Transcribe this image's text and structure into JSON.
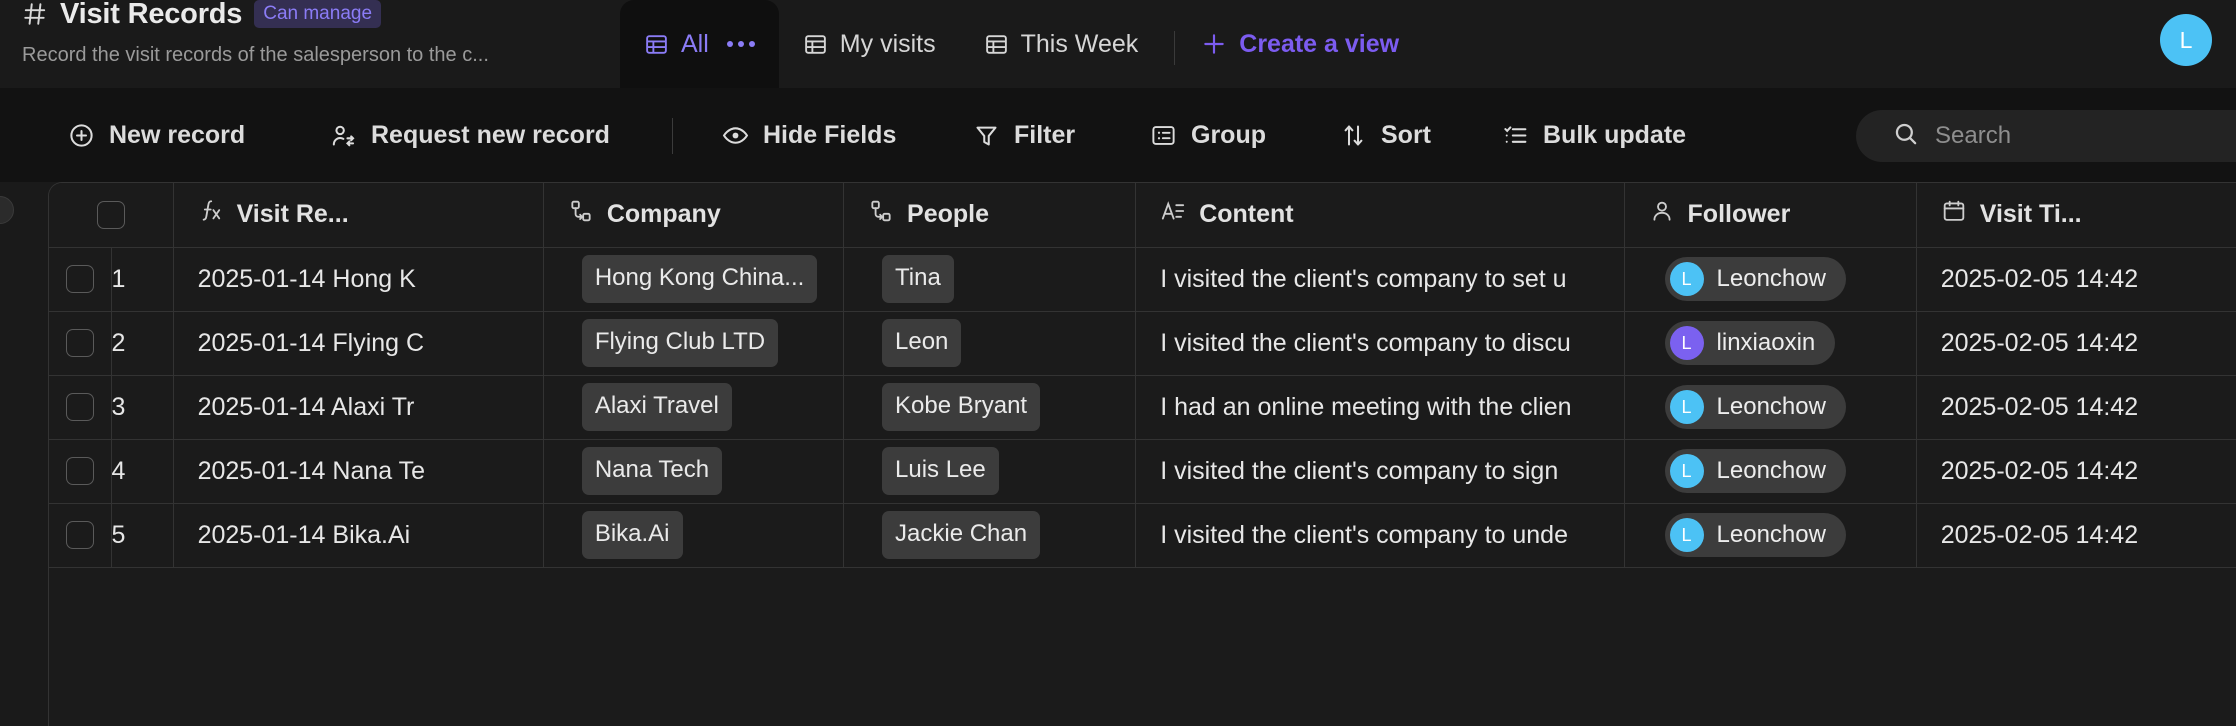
{
  "header": {
    "hash_icon": "hash-icon",
    "title": "Visit Records",
    "permission_badge": "Can manage",
    "subtitle": "Record the visit records of the salesperson to the c...",
    "avatar_initial": "L",
    "avatar_color": "#4cc2f5"
  },
  "tabs": {
    "items": [
      {
        "label": "All",
        "icon": "grid-table-icon",
        "active": true,
        "has_more": true
      },
      {
        "label": "My visits",
        "icon": "grid-table-icon",
        "active": false,
        "has_more": false
      },
      {
        "label": "This Week",
        "icon": "grid-table-icon",
        "active": false,
        "has_more": false
      }
    ],
    "create_view_label": "Create a view",
    "create_view_icon": "plus-icon",
    "accent_color": "#7c5cf0"
  },
  "toolbar": {
    "new_record": "New record",
    "request_new_record": "Request new record",
    "hide_fields": "Hide Fields",
    "filter": "Filter",
    "group": "Group",
    "sort": "Sort",
    "bulk_update": "Bulk update",
    "search_placeholder": "Search",
    "search_value": ""
  },
  "grid": {
    "columns": [
      {
        "label": "Visit Re...",
        "icon": "formula-icon"
      },
      {
        "label": "Company",
        "icon": "relation-link-icon"
      },
      {
        "label": "People",
        "icon": "relation-link-icon"
      },
      {
        "label": "Content",
        "icon": "long-text-icon"
      },
      {
        "label": "Follower",
        "icon": "person-icon"
      },
      {
        "label": "Visit Ti...",
        "icon": "calendar-icon"
      }
    ],
    "rows": [
      {
        "index": "1",
        "title": "2025-01-14 Hong K",
        "company": "Hong Kong China...",
        "people": "Tina",
        "content": "I visited the client's company to set u",
        "follower": "Leonchow",
        "follower_initial": "L",
        "follower_color": "#4cc2f5",
        "visit_time": "2025-02-05 14:42"
      },
      {
        "index": "2",
        "title": "2025-01-14 Flying C",
        "company": "Flying Club LTD",
        "people": "Leon",
        "content": "I visited the client's company to discu",
        "follower": "linxiaoxin",
        "follower_initial": "L",
        "follower_color": "#7b61f0",
        "visit_time": "2025-02-05 14:42"
      },
      {
        "index": "3",
        "title": "2025-01-14 Alaxi Tr",
        "company": "Alaxi Travel",
        "people": "Kobe Bryant",
        "content": "I had an online meeting with the clien",
        "follower": "Leonchow",
        "follower_initial": "L",
        "follower_color": "#4cc2f5",
        "visit_time": "2025-02-05 14:42"
      },
      {
        "index": "4",
        "title": "2025-01-14 Nana Te",
        "company": "Nana Tech",
        "people": "Luis Lee",
        "content": "I visited the client's company to sign ",
        "follower": "Leonchow",
        "follower_initial": "L",
        "follower_color": "#4cc2f5",
        "visit_time": "2025-02-05 14:42"
      },
      {
        "index": "5",
        "title": "2025-01-14 Bika.Ai",
        "company": "Bika.Ai",
        "people": "Jackie Chan",
        "content": "I visited the client's company to unde",
        "follower": "Leonchow",
        "follower_initial": "L",
        "follower_color": "#4cc2f5",
        "visit_time": "2025-02-05 14:42"
      }
    ]
  }
}
